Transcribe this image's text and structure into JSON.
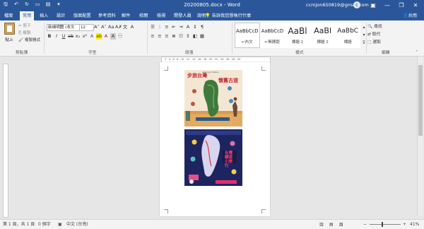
{
  "window": {
    "title": "20200805.docx - Word",
    "account": "ccmjon650819@gmail.com",
    "avatar_letter": "c",
    "minimize_glyph": "—",
    "maximize_glyph": "❐",
    "close_glyph": "✕"
  },
  "quick_access": [
    {
      "icon": "save-icon",
      "glyph": "🖫"
    },
    {
      "icon": "undo-icon",
      "glyph": "↶"
    },
    {
      "icon": "redo-icon",
      "glyph": "↻"
    },
    {
      "icon": "app-icon",
      "glyph": "▭"
    },
    {
      "icon": "file-open-icon",
      "glyph": "▤"
    },
    {
      "icon": "customize-qat-icon",
      "glyph": "▾"
    }
  ],
  "tabs": [
    "檔案",
    "常用",
    "插入",
    "設計",
    "版面配置",
    "參考資料",
    "郵件",
    "校閱",
    "檢視",
    "開發人員",
    "說明"
  ],
  "active_tab": "常用",
  "tell_me": "告訴我您想執行什麼",
  "share": "共用",
  "clipboard": {
    "paste": "貼上",
    "cut": "剪下",
    "copy": "複製",
    "format_painter": "複製格式",
    "group": "剪貼簿"
  },
  "font": {
    "name": "新細明體 (本文",
    "size": "12",
    "group": "字型"
  },
  "paragraph": {
    "group": "段落"
  },
  "styles": {
    "group": "樣式",
    "items": [
      {
        "sample": "AaBbCcD",
        "name": "↵內文"
      },
      {
        "sample": "AaBbCcD",
        "name": "↵無間距"
      },
      {
        "sample": "AaBl",
        "name": "標題 1"
      },
      {
        "sample": "AaBl",
        "name": "標題 2"
      },
      {
        "sample": "AaBbC",
        "name": "標題"
      }
    ]
  },
  "editing": {
    "group": "編輯",
    "find": "尋找",
    "replace": "取代",
    "select": "選取"
  },
  "document": {
    "poster1": {
      "title_left": "步旅台灣",
      "title_right": "懷舊古道",
      "subtitle": "Discover Taiwan"
    },
    "poster2": {
      "title": "台灣鐵道小旅行"
    }
  },
  "statusbar": {
    "page": "第 1 頁，共 1 頁",
    "words": "0 個字",
    "language": "中文 (台灣)",
    "zoom": "41%"
  },
  "colors": {
    "word_blue": "#2b579a",
    "ribbon_bg": "#f3f3f3",
    "canvas_bg": "#e6e6e6"
  }
}
